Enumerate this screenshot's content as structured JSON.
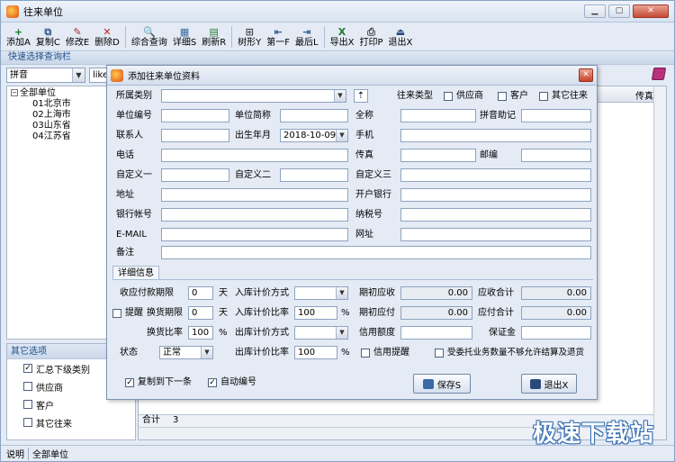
{
  "window": {
    "title": "往来单位",
    "min": "▁",
    "max": "▢",
    "close": "✕"
  },
  "toolbar": [
    {
      "key": "add",
      "label": "添加A",
      "icon": "plus-icon",
      "glyph": "+",
      "color": "#1d7a2a"
    },
    {
      "key": "copy",
      "label": "复制C",
      "icon": "copy-icon",
      "glyph": "⧉",
      "color": "#3a5a8c"
    },
    {
      "key": "edit",
      "label": "修改E",
      "icon": "edit-icon",
      "glyph": "✎",
      "color": "#b0302a"
    },
    {
      "key": "delete",
      "label": "删除D",
      "icon": "delete-icon",
      "glyph": "✕",
      "color": "#c81e1e"
    },
    {
      "key": "query",
      "label": "综合查询",
      "icon": "magnifier-icon",
      "glyph": "🔍",
      "color": "#2a5a8a"
    },
    {
      "key": "detail",
      "label": "详细S",
      "icon": "grid-icon",
      "glyph": "▦",
      "color": "#3a6aa0"
    },
    {
      "key": "refresh",
      "label": "刷新R",
      "icon": "refresh-icon",
      "glyph": "▤",
      "color": "#2e7a3a"
    },
    {
      "key": "tree",
      "label": "树形Y",
      "icon": "tree-icon",
      "glyph": "⊞",
      "color": "#4a4a4a"
    },
    {
      "key": "first",
      "label": "第一F",
      "icon": "first-icon",
      "glyph": "⇤",
      "color": "#2a5a8a"
    },
    {
      "key": "last",
      "label": "最后L",
      "icon": "last-icon",
      "glyph": "⇥",
      "color": "#2a5a8a"
    },
    {
      "key": "export",
      "label": "导出X",
      "icon": "excel-icon",
      "glyph": "X",
      "color": "#1f7a2e"
    },
    {
      "key": "print",
      "label": "打印P",
      "icon": "printer-icon",
      "glyph": "⎙",
      "color": "#444"
    },
    {
      "key": "exit",
      "label": "退出X",
      "icon": "exit-icon",
      "glyph": "⏏",
      "color": "#2a4a7a"
    }
  ],
  "quickbar": "快速选择查询栏",
  "search": {
    "field": "拼音",
    "op": "like"
  },
  "tree": {
    "root": "全部单位",
    "children": [
      "01北京市",
      "02上海市",
      "03山东省",
      "04江苏省"
    ]
  },
  "grid": {
    "last_col": "传真",
    "footer_label": "合计",
    "footer_count": "3"
  },
  "other": {
    "title": "其它选项",
    "items": [
      {
        "label": "汇总下级类别",
        "checked": true
      },
      {
        "label": "供应商",
        "checked": false
      },
      {
        "label": "客户",
        "checked": false
      },
      {
        "label": "其它往来",
        "checked": false
      }
    ]
  },
  "status": {
    "label": "说明",
    "value": "全部单位"
  },
  "watermark": "极速下载站",
  "dialog": {
    "title": "添加往来单位资料",
    "close": "✕",
    "labels": {
      "category": "所属类别",
      "type": "往来类型",
      "supplier": "供应商",
      "customer": "客户",
      "other": "其它往来",
      "code": "单位编号",
      "short": "单位简称",
      "fullname": "全称",
      "pinyin": "拼音助记",
      "contact": "联系人",
      "birth": "出生年月",
      "mobile": "手机",
      "phone": "电话",
      "fax": "传真",
      "postcode": "邮编",
      "custom1": "自定义一",
      "custom2": "自定义二",
      "custom3": "自定义三",
      "address": "地址",
      "bank": "开户银行",
      "account": "银行帐号",
      "taxno": "纳税号",
      "email": "E-MAIL",
      "website": "网址",
      "note": "备注",
      "detail_tab": "详细信息",
      "pay_days": "收应付款期限",
      "day1": "天",
      "in_price": "入库计价方式",
      "init_recv": "期初应收",
      "recv_total": "应收合计",
      "remind": "提醒",
      "swap_days": "换货期限",
      "day2": "天",
      "in_ratio": "入库计价比率",
      "pct1": "%",
      "init_pay": "期初应付",
      "pay_total": "应付合计",
      "swap_ratio": "换货比率",
      "pct2": "%",
      "out_price": "出库计价方式",
      "credit": "信用额度",
      "deposit": "保证金",
      "state": "状态",
      "out_ratio": "出库计价比率",
      "pct3": "%",
      "credit_remind": "信用提醒",
      "consign": "受委托业务数量不够允许结算及退货",
      "copy_next": "复制到下一条",
      "auto_no": "自动编号"
    },
    "values": {
      "birth": "2018-10-09",
      "pay_days": "0",
      "swap_days": "0",
      "swap_ratio": "100",
      "in_ratio": "100",
      "out_ratio": "100",
      "init_recv": "0.00",
      "recv_total": "0.00",
      "init_pay": "0.00",
      "pay_total": "0.00",
      "state": "正常"
    },
    "buttons": {
      "save": "保存S",
      "exit": "退出X"
    }
  }
}
